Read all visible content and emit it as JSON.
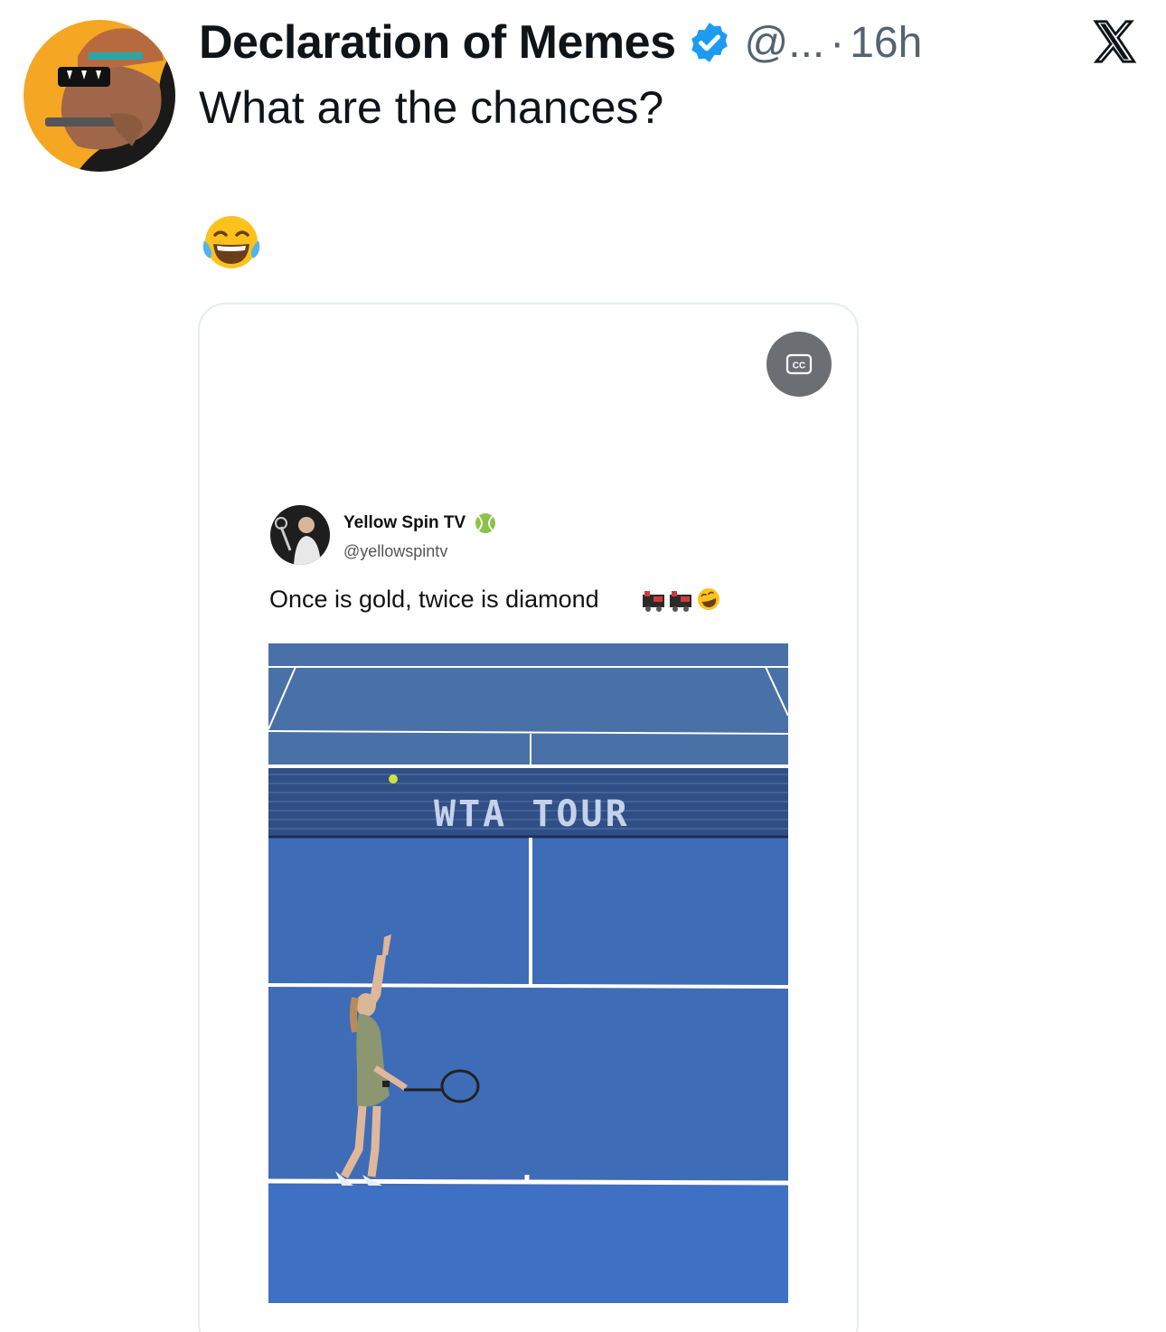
{
  "tweet": {
    "display_name": "Declaration of Memes",
    "handle": "@...",
    "separator": "·",
    "time": "16h",
    "text": "What are the chances?",
    "emoji": "😂",
    "verified_color": "#1d9bf0"
  },
  "embedded_post": {
    "name": "Yellow Spin TV",
    "handle": "@yellowspintv",
    "text": "Once is gold, twice is diamond",
    "emojis": "🚂🚂🤣",
    "court_banner": "WTA TOUR"
  },
  "icons": {
    "avatar": "cartoon-horse-avatar",
    "verified": "verified-badge-icon",
    "brand": "x-logo-icon",
    "captions": "closed-captions-icon",
    "tennis": "tennis-ball-icon"
  },
  "colors": {
    "court": "#3f6cb6",
    "court_dark": "#4a70a8",
    "avatar_bg": "#f5a623"
  }
}
